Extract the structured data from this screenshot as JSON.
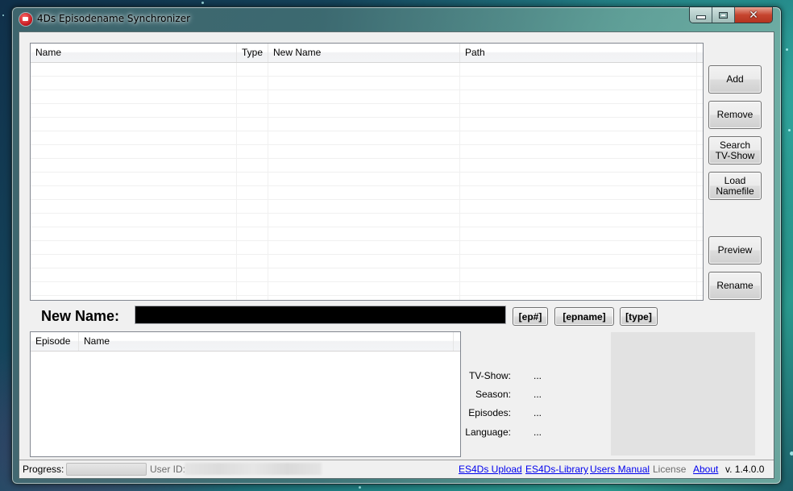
{
  "window": {
    "title": "4Ds Episodename Synchronizer",
    "controls": {
      "minimize": "minimize",
      "maximize": "maximize",
      "close": "close"
    }
  },
  "file_list": {
    "columns": [
      "Name",
      "Type",
      "New Name",
      "Path"
    ],
    "rows": []
  },
  "side_buttons": {
    "add": "Add",
    "remove": "Remove",
    "search_line1": "Search",
    "search_line2": "TV-Show",
    "load_line1": "Load",
    "load_line2": "Namefile",
    "preview": "Preview",
    "rename": "Rename"
  },
  "new_name": {
    "label": "New Name:",
    "value": "",
    "tags": [
      "[ep#]",
      "[epname]",
      "[type]"
    ]
  },
  "episode_list": {
    "columns": [
      "Episode",
      "Name"
    ],
    "rows": []
  },
  "show_info": {
    "tv_show_label": "TV-Show:",
    "tv_show_value": "...",
    "season_label": "Season:",
    "season_value": "...",
    "episodes_label": "Episodes:",
    "episodes_value": "...",
    "language_label": "Language:",
    "language_value": "..."
  },
  "status_bar": {
    "progress_label": "Progress:",
    "progress_value": 0,
    "user_id_label": "User ID:",
    "links": {
      "upload": "ES4Ds Upload",
      "library": "ES4Ds-Library",
      "manual": "Users Manual",
      "license": "License",
      "about": "About"
    },
    "version": "v. 1.4.0.0"
  }
}
